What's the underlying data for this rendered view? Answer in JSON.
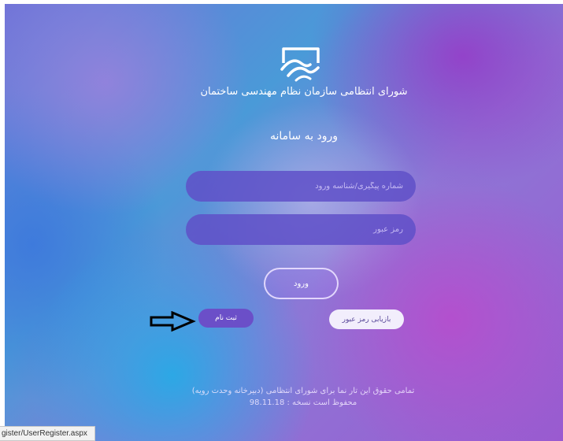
{
  "header": {
    "logo_icon": "handshake-building-icon",
    "org_name": "شورای انتظامی سازمان نظام مهندسی ساختمان"
  },
  "login": {
    "title": "ورود به سامانه",
    "username_placeholder": "شماره پیگیری/شناسه ورود",
    "password_placeholder": "رمز عبور",
    "login_label": "ورود",
    "register_label": "ثبت نام",
    "recover_label": "بازیابی رمز عبور"
  },
  "annotation": {
    "arrow_icon": "right-arrow-icon"
  },
  "footer": {
    "line1": "تمامی حقوق این تار نما برای شورای انتظامی (دبیرخانه وحدت رویه)",
    "line2": "محفوظ است نسخه : 98.11.18"
  },
  "status_bar": {
    "url": "gister/UserRegister.aspx"
  }
}
